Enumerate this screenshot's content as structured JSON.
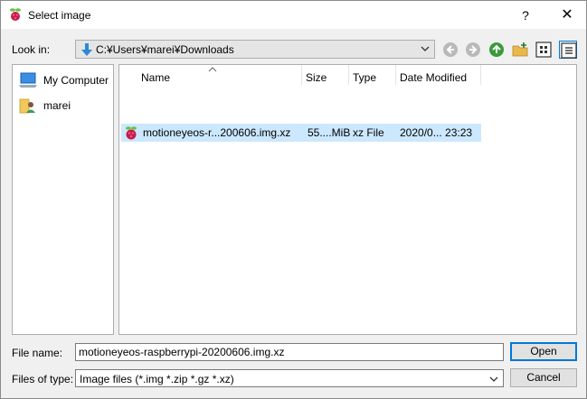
{
  "window": {
    "title": "Select image",
    "help": "?",
    "close": "✕"
  },
  "lookin": {
    "label": "Look in:",
    "path": "C:¥Users¥marei¥Downloads"
  },
  "places": [
    {
      "label": "My Computer",
      "icon": "computer-icon"
    },
    {
      "label": "marei",
      "icon": "user-folder-icon"
    }
  ],
  "columns": {
    "name": "Name",
    "size": "Size",
    "type": "Type",
    "date": "Date Modified"
  },
  "files": [
    {
      "name": "motioneyeos-r...200606.img.xz",
      "size": "55....MiB",
      "type": "xz File",
      "date": "2020/0... 23:23",
      "icon": "raspberry-icon"
    }
  ],
  "filename": {
    "label": "File name:",
    "value": "motioneyeos-raspberrypi-20200606.img.xz"
  },
  "filetype": {
    "label": "Files of type:",
    "value": "Image files (*.img *.zip *.gz *.xz)"
  },
  "buttons": {
    "open": "Open",
    "cancel": "Cancel"
  },
  "colors": {
    "accent": "#0078d7",
    "selection": "#cce8ff",
    "raspberry": "#c51a4a",
    "leaf": "#6cc04a"
  }
}
